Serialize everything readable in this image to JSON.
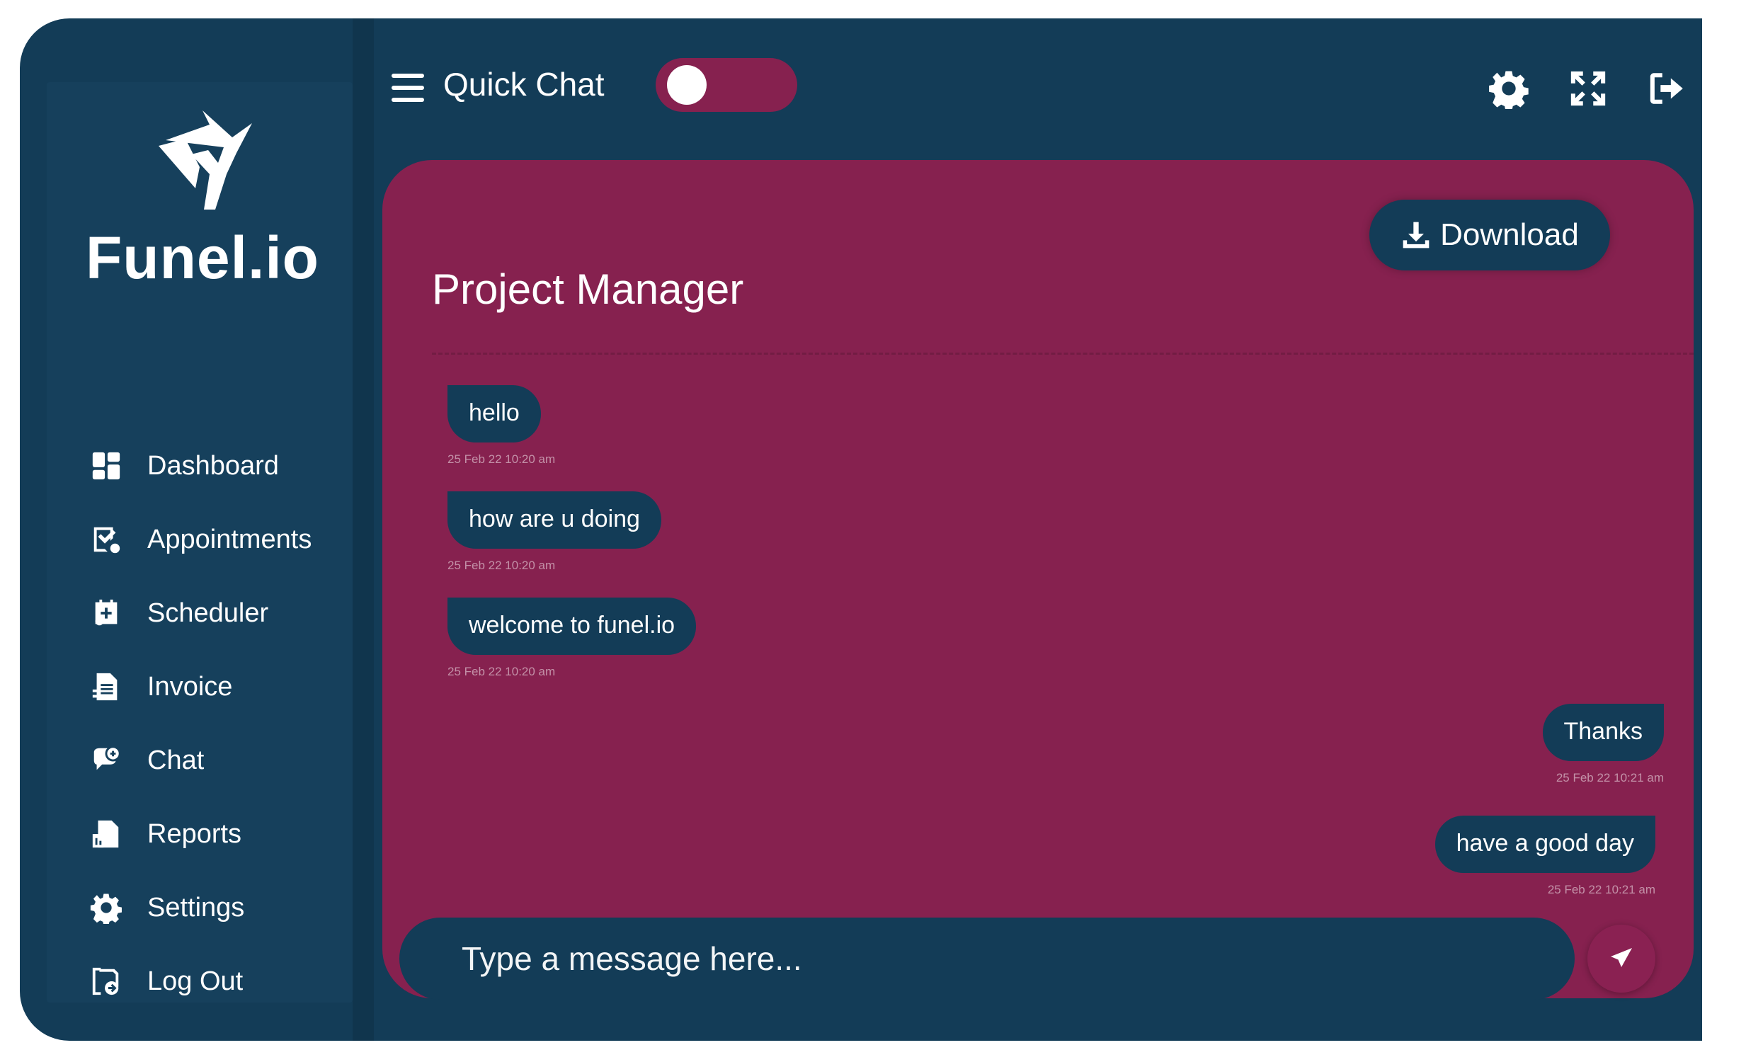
{
  "brand": {
    "name": "Funel.io"
  },
  "sidebar": {
    "items": [
      {
        "label": "Dashboard",
        "icon": "dashboard-icon"
      },
      {
        "label": "Appointments",
        "icon": "appointments-icon"
      },
      {
        "label": "Scheduler",
        "icon": "scheduler-icon"
      },
      {
        "label": "Invoice",
        "icon": "invoice-icon"
      },
      {
        "label": "Chat",
        "icon": "chat-icon"
      },
      {
        "label": "Reports",
        "icon": "reports-icon"
      },
      {
        "label": "Settings",
        "icon": "gear-icon"
      },
      {
        "label": "Log Out",
        "icon": "logout-icon"
      }
    ]
  },
  "header": {
    "title": "Quick Chat",
    "toggle_on": false
  },
  "chat": {
    "download_label": "Download",
    "title": "Project Manager",
    "messages": [
      {
        "direction": "in",
        "text": "hello",
        "time": "25 Feb 22 10:20 am"
      },
      {
        "direction": "in",
        "text": "how are u doing",
        "time": "25 Feb 22 10:20 am"
      },
      {
        "direction": "in",
        "text": "welcome to funel.io",
        "time": "25 Feb 22 10:20 am"
      },
      {
        "direction": "out",
        "text": "Thanks",
        "time": "25 Feb 22 10:21 am"
      },
      {
        "direction": "out",
        "text": "have a good day",
        "time": "25 Feb 22 10:21 am"
      }
    ],
    "input": {
      "value": "",
      "placeholder": "Type a message here..."
    }
  },
  "colors": {
    "background": "#133c57",
    "sidebar": "#16405c",
    "panel": "#86214f",
    "bubble": "#133c57",
    "text": "#ffffff"
  }
}
